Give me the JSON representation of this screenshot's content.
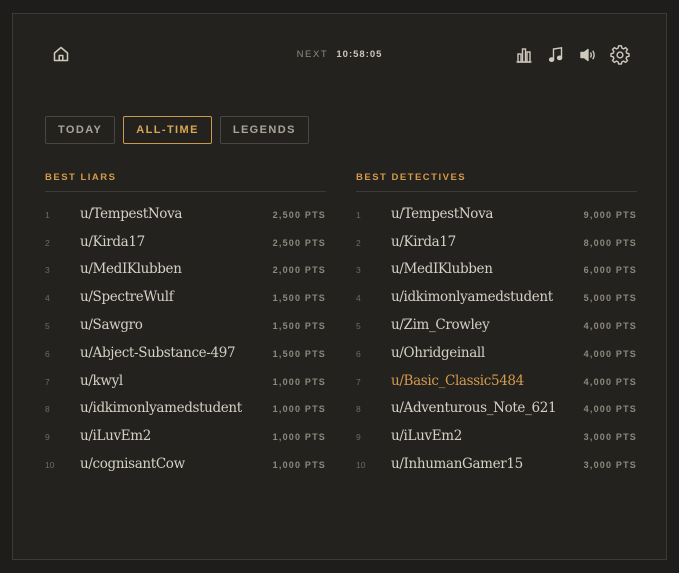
{
  "header": {
    "next_label": "NEXT",
    "next_time": "10:58:05",
    "icons": [
      "home-icon",
      "stats-icon",
      "music-icon",
      "volume-icon",
      "settings-icon"
    ]
  },
  "tabs": [
    {
      "label": "TODAY",
      "active": false
    },
    {
      "label": "ALL-TIME",
      "active": true
    },
    {
      "label": "LEGENDS",
      "active": false
    }
  ],
  "colors": {
    "accent": "#d49a4c",
    "background": "#23221f",
    "text": "#d6d0c4"
  },
  "best_liars": {
    "title": "BEST LIARS",
    "rows": [
      {
        "rank": "1",
        "user": "u/TempestNova",
        "points": "2,500 PTS"
      },
      {
        "rank": "2",
        "user": "u/Kirda17",
        "points": "2,500 PTS"
      },
      {
        "rank": "3",
        "user": "u/MedIKlubben",
        "points": "2,000 PTS"
      },
      {
        "rank": "4",
        "user": "u/SpectreWulf",
        "points": "1,500 PTS"
      },
      {
        "rank": "5",
        "user": "u/Sawgro",
        "points": "1,500 PTS"
      },
      {
        "rank": "6",
        "user": "u/Abject-Substance-497",
        "points": "1,500 PTS"
      },
      {
        "rank": "7",
        "user": "u/kwyl",
        "points": "1,000 PTS"
      },
      {
        "rank": "8",
        "user": "u/idkimonlyamedstudent",
        "points": "1,000 PTS"
      },
      {
        "rank": "9",
        "user": "u/iLuvEm2",
        "points": "1,000 PTS"
      },
      {
        "rank": "10",
        "user": "u/cognisantCow",
        "points": "1,000 PTS"
      }
    ]
  },
  "best_detectives": {
    "title": "BEST DETECTIVES",
    "rows": [
      {
        "rank": "1",
        "user": "u/TempestNova",
        "points": "9,000 PTS"
      },
      {
        "rank": "2",
        "user": "u/Kirda17",
        "points": "8,000 PTS"
      },
      {
        "rank": "3",
        "user": "u/MedIKlubben",
        "points": "6,000 PTS"
      },
      {
        "rank": "4",
        "user": "u/idkimonlyamedstudent",
        "points": "5,000 PTS"
      },
      {
        "rank": "5",
        "user": "u/Zim_Crowley",
        "points": "4,000 PTS"
      },
      {
        "rank": "6",
        "user": "u/Ohridgeinall",
        "points": "4,000 PTS"
      },
      {
        "rank": "7",
        "user": "u/Basic_Classic5484",
        "points": "4,000 PTS",
        "highlight": true
      },
      {
        "rank": "8",
        "user": "u/Adventurous_Note_621",
        "points": "4,000 PTS"
      },
      {
        "rank": "9",
        "user": "u/iLuvEm2",
        "points": "3,000 PTS"
      },
      {
        "rank": "10",
        "user": "u/InhumanGamer15",
        "points": "3,000 PTS"
      }
    ]
  }
}
